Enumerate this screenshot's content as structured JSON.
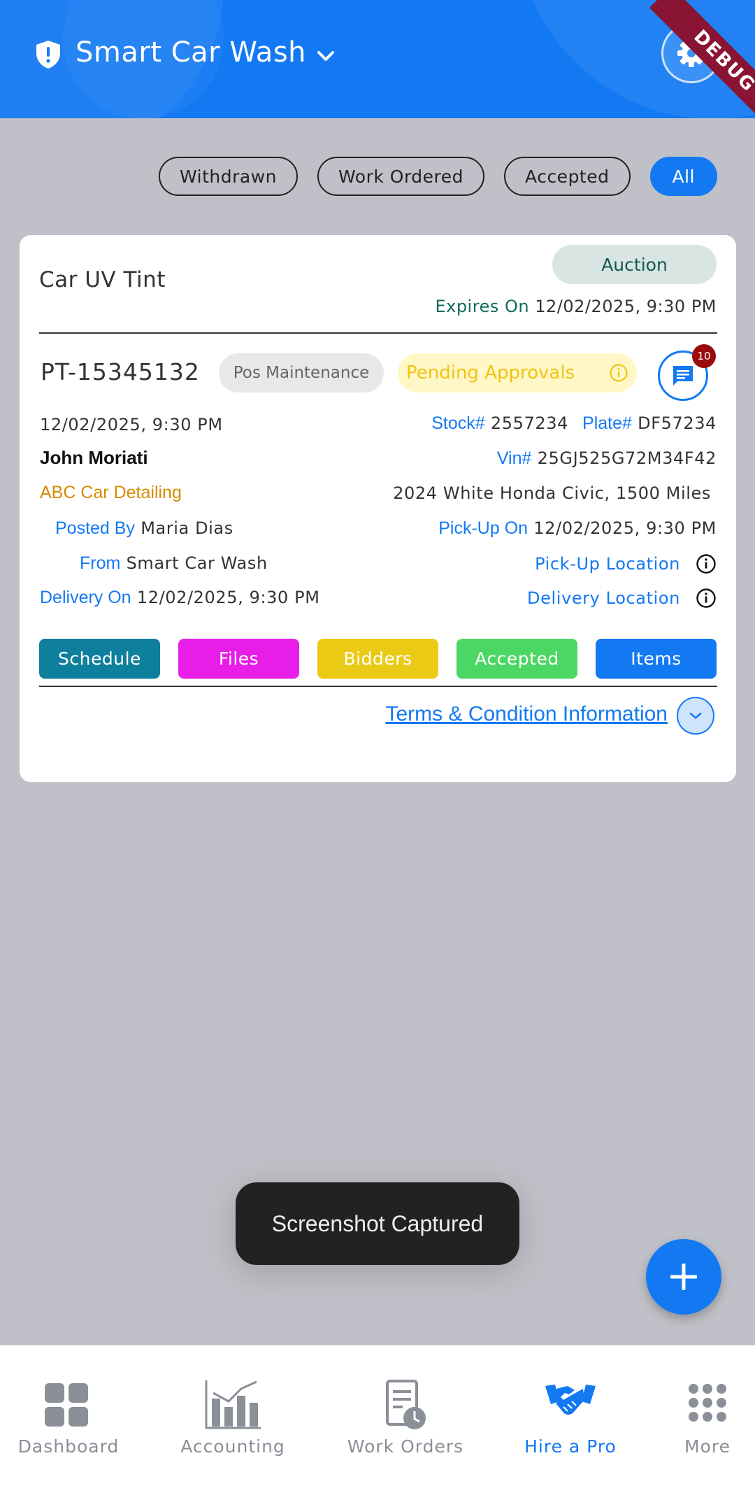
{
  "header": {
    "title": "Smart Car Wash",
    "debug_banner": "DEBUG"
  },
  "filters": [
    {
      "label": "Withdrawn",
      "active": false
    },
    {
      "label": "Work Ordered",
      "active": false
    },
    {
      "label": "Accepted",
      "active": false
    },
    {
      "label": "All",
      "active": true
    }
  ],
  "job": {
    "title": "Car UV Tint",
    "type_badge": "Auction",
    "expires_label": "Expires On",
    "expires_value": "12/02/2025, 9:30 PM",
    "id": "PT-15345132",
    "category_badge": "Pos Maintenance",
    "status_badge": "Pending Approvals",
    "message_count": "10",
    "date": "12/02/2025, 9:30 PM",
    "stock_label": "Stock#",
    "stock_value": "2557234",
    "plate_label": "Plate#",
    "plate_value": "DF57234",
    "customer": "John Moriati",
    "vin_label": "Vin#",
    "vin_value": "25GJ525G72M34F42",
    "vendor": "ABC Car Detailing",
    "vehicle": "2024 White Honda Civic, 1500 Miles",
    "posted_by_label": "Posted By",
    "posted_by_value": "Maria Dias",
    "pickup_label": "Pick-Up On",
    "pickup_value": "12/02/2025, 9:30 PM",
    "from_label": "From",
    "from_value": "Smart Car Wash",
    "pickup_location_label": "Pick-Up Location",
    "delivery_label": "Delivery On",
    "delivery_value": "12/02/2025, 9:30 PM",
    "delivery_location_label": "Delivery Location",
    "actions": [
      {
        "label": "Schedule",
        "color": "#0e7f9c"
      },
      {
        "label": "Files",
        "color": "#e81ee8"
      },
      {
        "label": "Bidders",
        "color": "#ebca16"
      },
      {
        "label": "Accepted",
        "color": "#4cd664"
      },
      {
        "label": "Items",
        "color": "#1379f3"
      }
    ],
    "terms_link": "Terms & Condition Information"
  },
  "toast": "Screenshot Captured",
  "nav": [
    {
      "label": "Dashboard",
      "icon": "dashboard-icon",
      "active": false
    },
    {
      "label": "Accounting",
      "icon": "accounting-chart-icon",
      "active": false
    },
    {
      "label": "Work Orders",
      "icon": "work-orders-icon",
      "active": false
    },
    {
      "label": "Hire a Pro",
      "icon": "handshake-icon",
      "active": true
    },
    {
      "label": "More",
      "icon": "more-grid-icon",
      "active": false
    }
  ],
  "colors": {
    "primary": "#1379f3",
    "background": "#c0c1c8",
    "auction_badge_bg": "#d8e5e3",
    "pending_badge_bg": "#fff8c6",
    "pending_text": "#f0c315",
    "vendor_text": "#d68a00",
    "badge_red": "#9b0b0b"
  }
}
